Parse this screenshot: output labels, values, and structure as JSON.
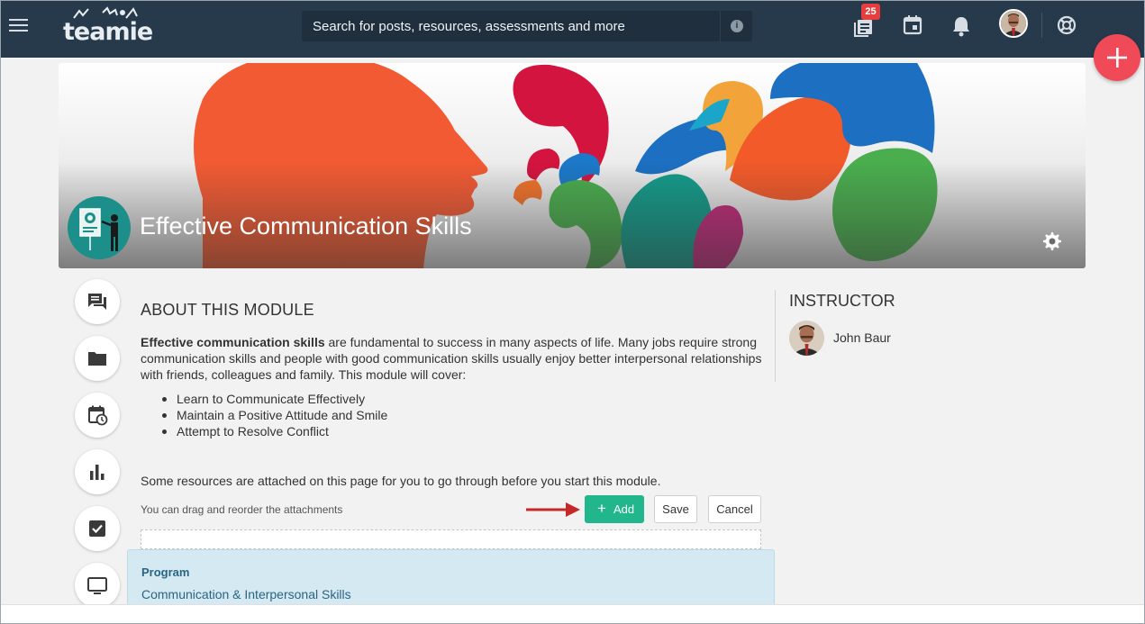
{
  "topbar": {
    "logo_text": "teamie",
    "search_placeholder": "Search for posts, resources, assessments and more",
    "notification_count": "25",
    "icons": [
      "menu-icon",
      "info-icon",
      "stack-icon",
      "calendar-icon",
      "bell-icon",
      "avatar",
      "lifebuoy-icon",
      "plus-icon"
    ]
  },
  "banner": {
    "title": "Effective Communication Skills"
  },
  "about": {
    "heading": "ABOUT THIS MODULE",
    "intro_bold": "Effective communication skills",
    "intro_rest": " are fundamental to success in many aspects of life. Many jobs require strong communication skills and people with good communication skills usually enjoy better interpersonal relationships with friends, colleagues and family. This module will cover:",
    "bullets": [
      "Learn to Communicate Effectively",
      "Maintain a Positive Attitude and Smile",
      "Attempt to Resolve Conflict"
    ],
    "resources_note": "Some resources are attached on this page for you to go through before you start this module.",
    "drag_note": "You can drag and reorder the attachments"
  },
  "actions": {
    "add_label": "Add",
    "save_label": "Save",
    "cancel_label": "Cancel"
  },
  "program": {
    "label": "Program",
    "value": "Communication & Interpersonal Skills"
  },
  "instructor": {
    "heading": "INSTRUCTOR",
    "name": "John Baur"
  },
  "rail": [
    "messages-icon",
    "folder-icon",
    "calendar-clock-icon",
    "bar-chart-icon",
    "checkbox-icon",
    "monitor-icon"
  ],
  "colors": {
    "topbar": "#273a4b",
    "accent_green": "#22b68c",
    "fab_red": "#f04a58",
    "program_bg": "#d4e9f2"
  }
}
